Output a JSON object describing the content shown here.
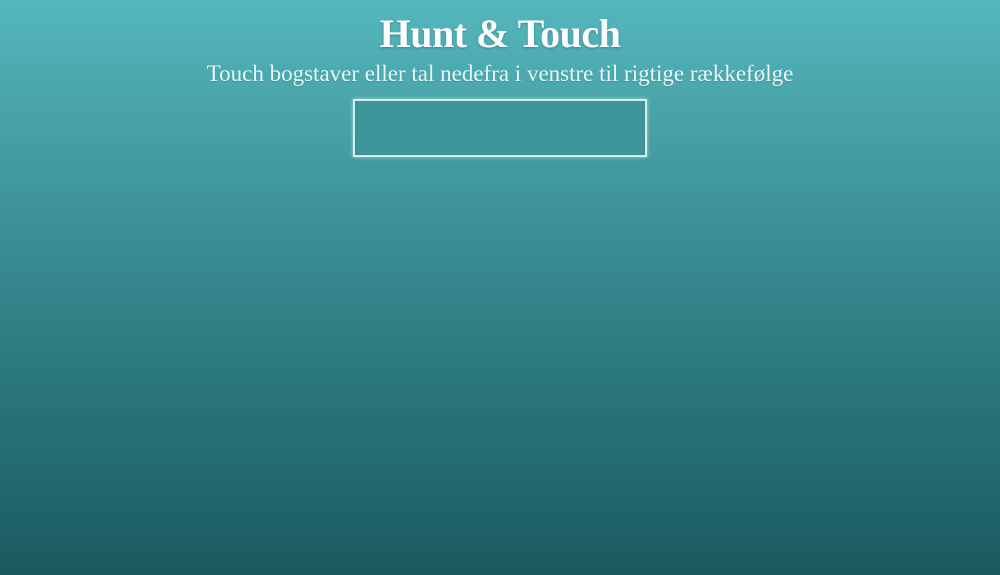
{
  "header": {
    "title": "Hunt & Touch",
    "instruction": "Touch bogstaver eller tal nedefra i venstre til rigtige rækkefølge"
  },
  "answer": {
    "value": ""
  },
  "colors": {
    "background_top": "#54b7bd",
    "background_bottom": "#1a5a5f",
    "answer_box_fill": "#3f969a",
    "answer_box_border": "#d6eeee",
    "text": "#ffffff"
  }
}
